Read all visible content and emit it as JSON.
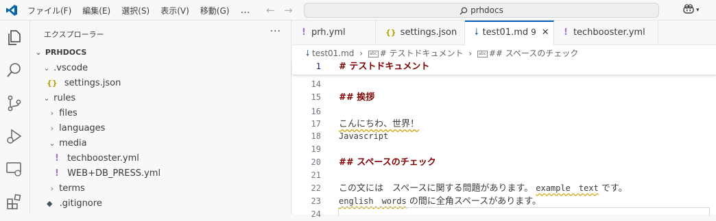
{
  "titlebar": {
    "menu": [
      "ファイル(F)",
      "編集(E)",
      "選択(S)",
      "表示(V)",
      "移動(G)"
    ],
    "more": "…",
    "search_text": "prhdocs",
    "colors": {
      "vscode_blue": "#0065a9",
      "accent": "#005fb8"
    }
  },
  "activity": [
    "explorer-icon",
    "search-icon",
    "source-control-icon",
    "run-debug-icon",
    "remote-explorer-icon",
    "extensions-icon"
  ],
  "sidebar": {
    "title": "エクスプローラー",
    "more": "···",
    "root": "PRHDOCS",
    "items": [
      {
        "label": ".vscode"
      },
      {
        "label": "settings.json"
      },
      {
        "label": "rules"
      },
      {
        "label": "files"
      },
      {
        "label": "languages"
      },
      {
        "label": "media"
      },
      {
        "label": "techbooster.yml"
      },
      {
        "label": "WEB+DB_PRESS.yml"
      },
      {
        "label": "terms"
      },
      {
        "label": ".gitignore"
      }
    ]
  },
  "tabs": [
    {
      "label": "prh.yml"
    },
    {
      "label": "settings.json"
    },
    {
      "label": "test01.md",
      "badge": "9"
    },
    {
      "label": "techbooster.yml"
    }
  ],
  "breadcrumb": {
    "file": "test01.md",
    "section1": "# テストドキュメント",
    "section2": "## スペースのチェック"
  },
  "editor": {
    "sticky": {
      "num": "1",
      "text": "# テストドキュメント"
    },
    "lines": [
      {
        "num": "14",
        "text": ""
      },
      {
        "num": "15",
        "text": "## 挨拶"
      },
      {
        "num": "16",
        "text": ""
      },
      {
        "num": "17",
        "text": "こんにちわ、世界！"
      },
      {
        "num": "18",
        "text": "Javascript"
      },
      {
        "num": "19",
        "text": ""
      },
      {
        "num": "20",
        "text": "## スペースのチェック"
      },
      {
        "num": "21",
        "text": ""
      },
      {
        "num": "22a",
        "text": "この文には　スペースに関する問題があります。 "
      },
      {
        "num": "22b",
        "text": "example　text"
      },
      {
        "num": "22c",
        "text": " です。"
      },
      {
        "num": "23a",
        "text": "english　words"
      },
      {
        "num": "23b",
        "text": " の間に全角スペースがあります。"
      },
      {
        "num": "22",
        "text": ""
      },
      {
        "num": "23",
        "text": ""
      },
      {
        "num": "24",
        "text": ""
      }
    ]
  }
}
